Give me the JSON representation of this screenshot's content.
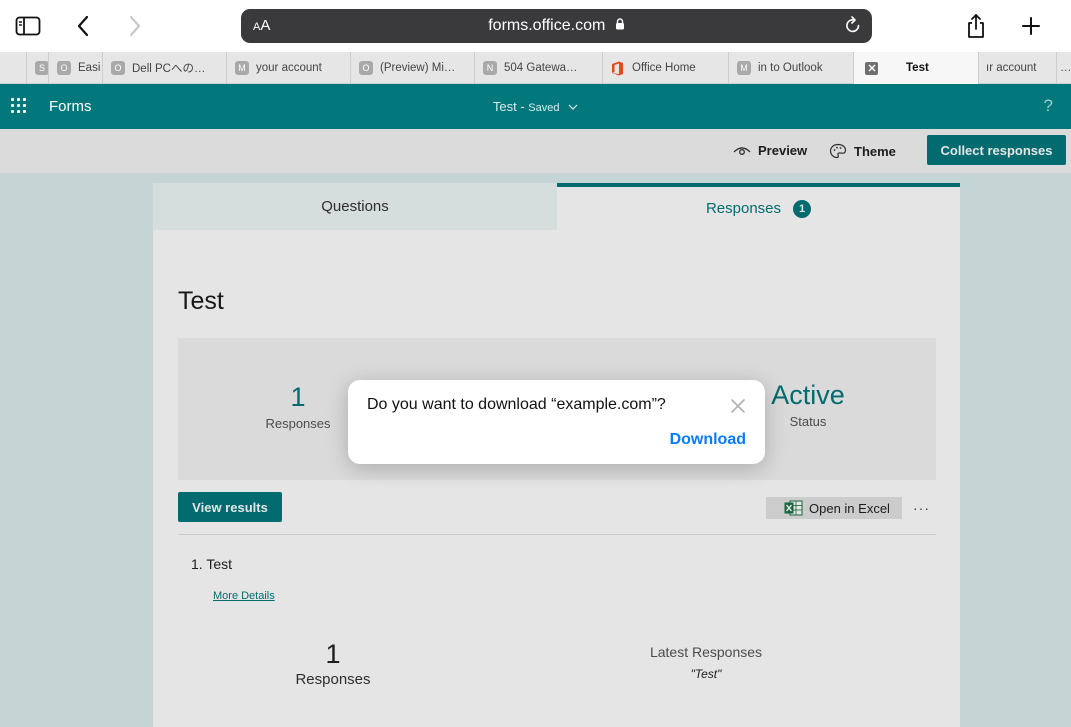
{
  "browser": {
    "address": {
      "text_size_label": "AA",
      "url": "forms.office.com"
    },
    "tabs": [
      {
        "icon": "S",
        "label": ""
      },
      {
        "icon": "O",
        "label": "Easi"
      },
      {
        "icon": "O",
        "label": "Dell PCへの…"
      },
      {
        "icon": "M",
        "label": "your account"
      },
      {
        "icon": "O",
        "label": "(Preview) Mi…"
      },
      {
        "icon": "N",
        "label": "504 Gatewa…"
      },
      {
        "icon": "office-logo",
        "label": "Office Home"
      },
      {
        "icon": "M",
        "label": "in to Outlook"
      },
      {
        "icon": "close",
        "label": "Test"
      },
      {
        "icon": "",
        "label": "ır account"
      }
    ]
  },
  "header": {
    "app_name": "Forms",
    "doc_title": "Test",
    "doc_status": "Saved",
    "help": "?"
  },
  "commands": {
    "preview": "Preview",
    "theme": "Theme",
    "collect": "Collect responses"
  },
  "form": {
    "tabs": {
      "questions": "Questions",
      "responses": "Responses",
      "responses_count": "1"
    },
    "title": "Test",
    "summary": {
      "responses_value": "1",
      "responses_label": "Responses",
      "status_value": "Active",
      "status_label": "Status"
    },
    "view_results": "View results",
    "open_excel": "Open in Excel",
    "more": "···",
    "question": {
      "number": "1.",
      "title": "Test",
      "more_details": "More Details"
    },
    "detail": {
      "count": "1",
      "count_label": "Responses",
      "latest_label": "Latest Responses",
      "latest_value": "\"Test\""
    }
  },
  "dialog": {
    "message": "Do you want to download “example.com”?",
    "action": "Download"
  },
  "colors": {
    "brand": "#03787c",
    "ios_blue": "#0a7aff"
  }
}
